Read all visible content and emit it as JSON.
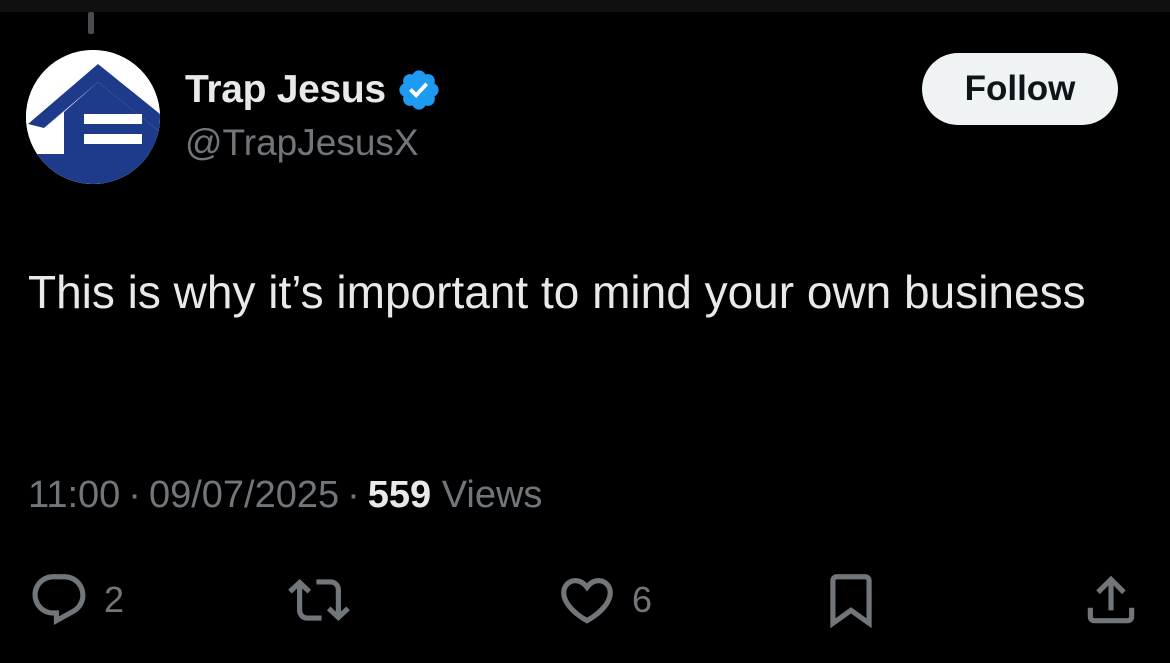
{
  "author": {
    "display_name": "Trap Jesus",
    "handle": "@TrapJesusX",
    "verified": true,
    "avatar_icon": "house-logo-icon"
  },
  "follow_button": {
    "label": "Follow"
  },
  "tweet": {
    "text": "This is why it’s important to mind your own business"
  },
  "meta": {
    "time": "11:00",
    "date": "09/07/2025",
    "views_count": "559",
    "views_label": "Views",
    "separator": "·"
  },
  "actions": {
    "reply": {
      "icon": "reply-icon",
      "count": "2"
    },
    "retweet": {
      "icon": "retweet-icon",
      "count": ""
    },
    "like": {
      "icon": "heart-icon",
      "count": "6"
    },
    "bookmark": {
      "icon": "bookmark-icon"
    },
    "share": {
      "icon": "share-icon"
    }
  },
  "colors": {
    "background": "#000000",
    "text_primary": "#e7e9ea",
    "text_secondary": "#71767b",
    "verified_blue": "#1d9bf0",
    "avatar_navy": "#1e3a8a",
    "follow_bg": "#eff3f4"
  }
}
